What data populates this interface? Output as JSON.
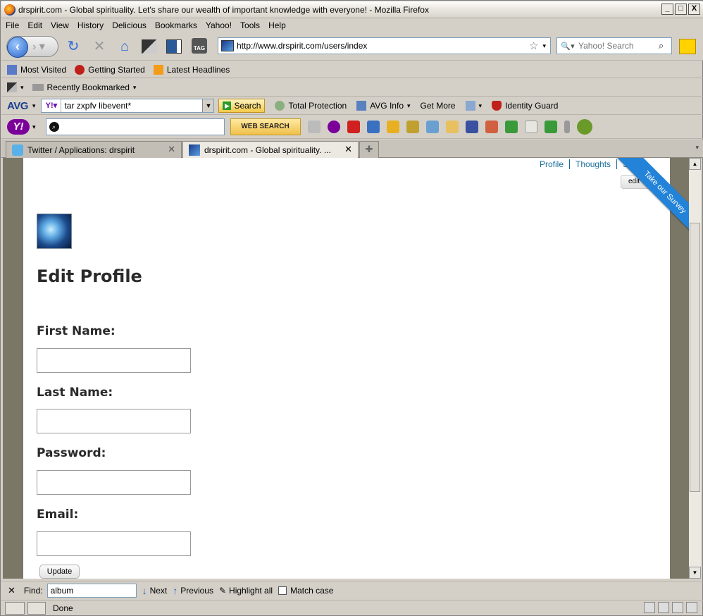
{
  "window": {
    "title": "drspirit.com - Global spirituality. Let's share our wealth of important knowledge with everyone! - Mozilla Firefox",
    "minimize": "_",
    "maximize": "□",
    "close": "X"
  },
  "menu": [
    "File",
    "Edit",
    "View",
    "History",
    "Delicious",
    "Bookmarks",
    "Yahoo!",
    "Tools",
    "Help"
  ],
  "nav": {
    "url": "http://www.drspirit.com/users/index",
    "search_placeholder": "Yahoo! Search"
  },
  "bookmarks": [
    "Most Visited",
    "Getting Started",
    "Latest Headlines"
  ],
  "recently_bookmarked": "Recently Bookmarked",
  "avg": {
    "logo": "AVG",
    "query": "tar zxpfv libevent*",
    "search_label": "Search",
    "items": [
      "Total Protection",
      "AVG Info",
      "Get More",
      "Identity Guard"
    ]
  },
  "yahoo": {
    "logo": "Y!",
    "web_search": "WEB SEARCH"
  },
  "tabs": [
    {
      "label": "Twitter / Applications: drspirit"
    },
    {
      "label": "drspirit.com - Global spirituality. ..."
    }
  ],
  "page": {
    "top_links": [
      "Profile",
      "Thoughts",
      "Si"
    ],
    "edit_button": "edit",
    "ribbon": "Take our Survey",
    "heading": "Edit Profile",
    "fields": [
      {
        "label": "First Name:",
        "value": ""
      },
      {
        "label": "Last Name:",
        "value": ""
      },
      {
        "label": "Password:",
        "value": ""
      },
      {
        "label": "Email:",
        "value": ""
      }
    ],
    "submit": "Update"
  },
  "find": {
    "label": "Find:",
    "value": "album",
    "next": "Next",
    "previous": "Previous",
    "highlight": "Highlight all",
    "match_case": "Match case"
  },
  "status": "Done"
}
